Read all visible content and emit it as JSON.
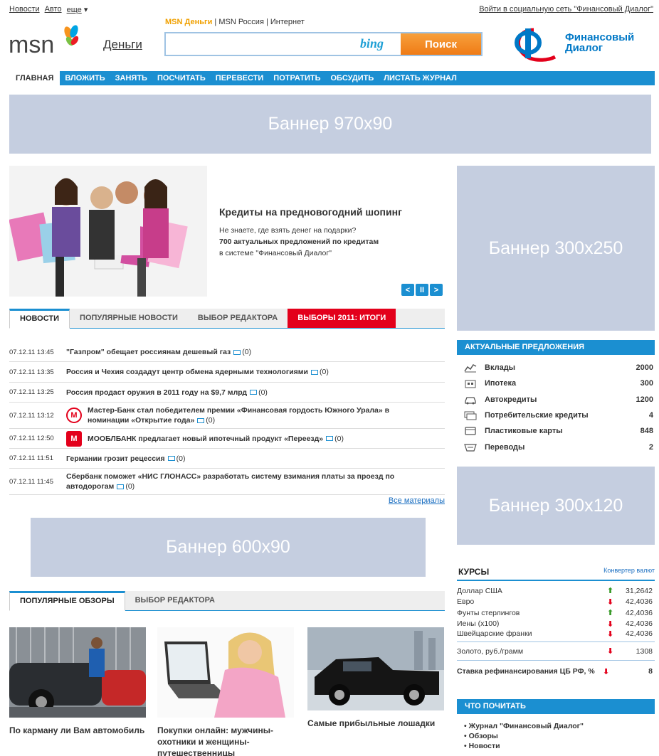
{
  "top": {
    "links": [
      "Новости",
      "Авто",
      "еще"
    ],
    "login": "Войти в социальную сеть \"Финансовый Диалог\""
  },
  "header": {
    "logo_text": "msn",
    "section": "Деньги",
    "search_tabs": {
      "active": "MSN Деньги",
      "others": [
        "MSN Россия",
        "Интернет"
      ]
    },
    "search_placeholder": "",
    "search_engine": "bing",
    "search_button": "Поиск",
    "partner": {
      "line1": "Финансовый",
      "line2": "Диалог"
    }
  },
  "nav": [
    "ГЛАВНАЯ",
    "ВЛОЖИТЬ",
    "ЗАНЯТЬ",
    "ПОСЧИТАТЬ",
    "ПЕРЕВЕСТИ",
    "ПОТРАТИТЬ",
    "ОБСУДИТЬ",
    "ЛИСТАТЬ ЖУРНАЛ"
  ],
  "banners": {
    "top": "Баннер 970x90",
    "right1": "Баннер 300x250",
    "right2": "Баннер 300x120",
    "middle": "Баннер 600x90"
  },
  "hero": {
    "title": "Кредиты на предновогодний шопинг",
    "desc1": "Не знаете, где взять денег на подарки?",
    "desc2": "700 актуальных предложений по кредитам",
    "desc3": "в системе \"Финансовый Диалог\"",
    "controls": [
      "<",
      "II",
      ">"
    ]
  },
  "news_tabs": [
    "НОВОСТИ",
    "ПОПУЛЯРНЫЕ НОВОСТИ",
    "ВЫБОР РЕДАКТОРА",
    "ВЫБОРЫ 2011: ИТОГИ"
  ],
  "news": [
    {
      "time": "07.12.11 13:45",
      "title": "\"Газпром\" обещает россиянам дешевый газ",
      "comments": "(0)",
      "icon": ""
    },
    {
      "time": "07.12.11 13:35",
      "title": "Россия и Чехия создадут центр обмена ядерными технологиями",
      "comments": "(0)",
      "icon": ""
    },
    {
      "time": "07.12.11 13:25",
      "title": "Россия продаст оружия в 2011 году на $9,7 млрд",
      "comments": "(0)",
      "icon": ""
    },
    {
      "time": "07.12.11 13:12",
      "title": "Мастер-Банк стал победителем премии «Финансовая гордость Южного Урала» в номинации «Открытие года»",
      "comments": "(0)",
      "icon": "master-bank-logo"
    },
    {
      "time": "07.12.11 12:50",
      "title": "МООБЛБАНК предлагает новый ипотечный продукт «Переезд»",
      "comments": "(0)",
      "icon": "mooblbank-logo"
    },
    {
      "time": "07.12.11 11:51",
      "title": "Германии грозит рецессия",
      "comments": "(0)",
      "icon": ""
    },
    {
      "time": "07.12.11 11:45",
      "title": "Сбербанк поможет «НИС ГЛОНАСС» разработать систему взимания платы за проезд по автодорогам",
      "comments": "(0)",
      "icon": ""
    }
  ],
  "all_materials": "Все материалы",
  "review_tabs": [
    "ПОПУЛЯРНЫЕ ОБЗОРЫ",
    "ВЫБОР РЕДАКТОРА"
  ],
  "reviews": [
    {
      "title": "По карману ли Вам автомобиль"
    },
    {
      "title": "Покупки онлайн: мужчины-охотники и женщины-путешественницы"
    },
    {
      "title": "Самые прибыльные лошадки"
    }
  ],
  "offers": {
    "title": "АКТУАЛЬНЫЕ ПРЕДЛОЖЕНИЯ",
    "items": [
      {
        "label": "Вклады",
        "value": "2000",
        "icon": "chart-icon"
      },
      {
        "label": "Ипотека",
        "value": "300",
        "icon": "house-icon"
      },
      {
        "label": "Автокредиты",
        "value": "1200",
        "icon": "car-icon"
      },
      {
        "label": "Потребительские кредиты",
        "value": "4",
        "icon": "cash-icon"
      },
      {
        "label": "Пластиковые карты",
        "value": "848",
        "icon": "card-icon"
      },
      {
        "label": "Переводы",
        "value": "2",
        "icon": "transfer-icon"
      }
    ]
  },
  "rates": {
    "title": "КУРСЫ",
    "converter": "Конвертер валют",
    "items": [
      {
        "name": "Доллар США",
        "dir": "up",
        "value": "31,2642"
      },
      {
        "name": "Евро",
        "dir": "down",
        "value": "42,4036"
      },
      {
        "name": "Фунты стерлингов",
        "dir": "up",
        "value": "42,4036"
      },
      {
        "name": "Иены (x100)",
        "dir": "down",
        "value": "42,4036"
      },
      {
        "name": "Швейцарские франки",
        "dir": "down",
        "value": "42,4036"
      }
    ],
    "gold": {
      "name": "Золото, руб./грамм",
      "dir": "down",
      "value": "1308"
    },
    "refi": {
      "name": "Ставка рефинансирования ЦБ РФ, %",
      "dir": "down",
      "value": "8"
    }
  },
  "read": {
    "title": "ЧТО ПОЧИТАТЬ",
    "items": [
      "Журнал \"Финансовый Диалог\"",
      "Обзоры",
      "Новости"
    ]
  },
  "colors": {
    "accent": "#1b8fd1",
    "orange": "#ef7b16",
    "red": "#e3001b",
    "banner": "#c5cee0"
  }
}
